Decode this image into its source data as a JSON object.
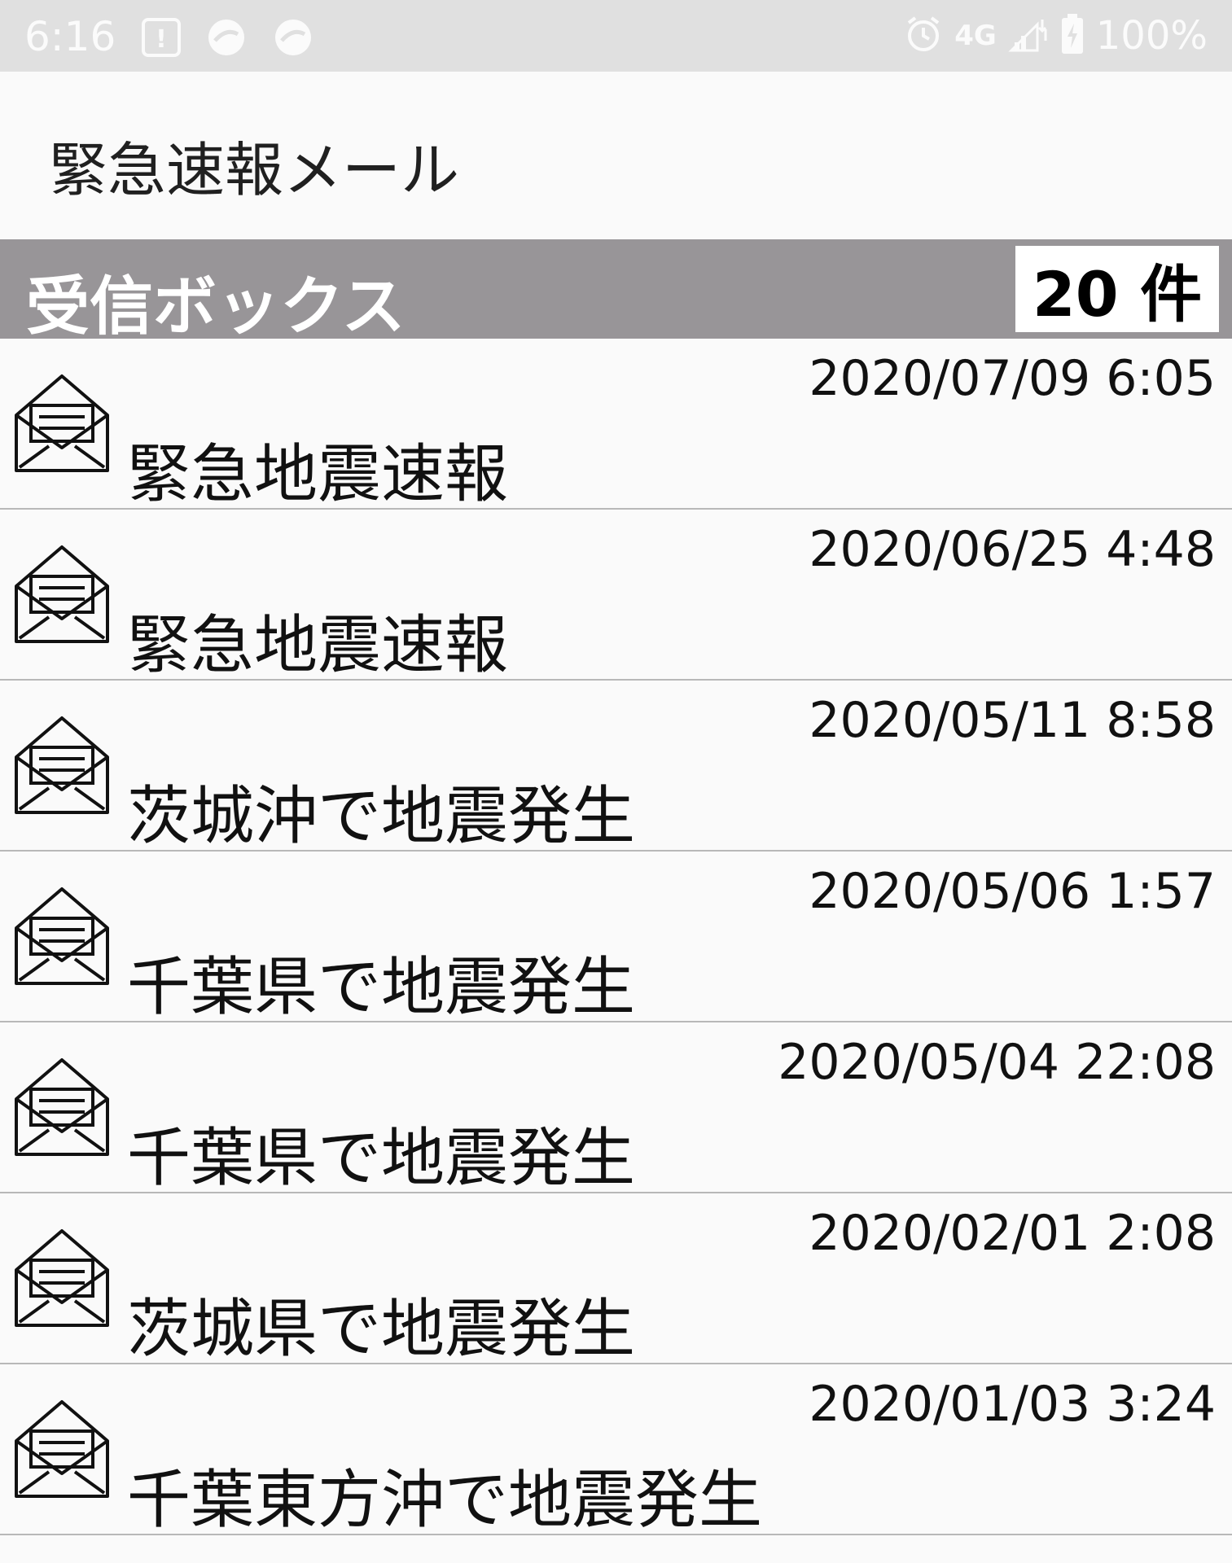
{
  "status_bar": {
    "time": "6:16",
    "network": "4G",
    "battery": "100%"
  },
  "app": {
    "title": "緊急速報メール"
  },
  "inbox": {
    "label": "受信ボックス",
    "count": "20 件"
  },
  "messages": [
    {
      "date": "2020/07/09 6:05",
      "subject": "緊急地震速報",
      "icon": "open-envelope-icon"
    },
    {
      "date": "2020/06/25 4:48",
      "subject": "緊急地震速報",
      "icon": "open-envelope-icon"
    },
    {
      "date": "2020/05/11 8:58",
      "subject": "茨城沖で地震発生",
      "icon": "open-envelope-icon"
    },
    {
      "date": "2020/05/06 1:57",
      "subject": "千葉県で地震発生",
      "icon": "open-envelope-icon"
    },
    {
      "date": "2020/05/04 22:08",
      "subject": "千葉県で地震発生",
      "icon": "open-envelope-icon"
    },
    {
      "date": "2020/02/01 2:08",
      "subject": "茨城県で地震発生",
      "icon": "open-envelope-icon"
    },
    {
      "date": "2020/01/03 3:24",
      "subject": "千葉東方沖で地震発生",
      "icon": "open-envelope-icon"
    }
  ],
  "colors": {
    "status_bar_bg": "#e0e0e0",
    "inbox_bar_bg": "#989598",
    "background": "#fafafa"
  }
}
